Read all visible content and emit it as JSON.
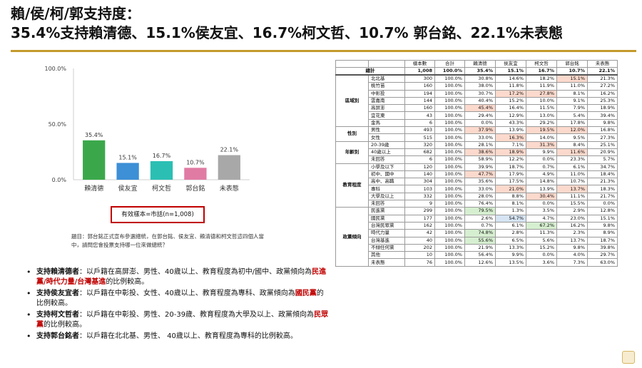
{
  "title": {
    "line1": "賴/侯/柯/郭支持度：",
    "line2": "35.4%支持賴清德、15.1%侯友宜、16.7%柯文哲、10.7% 郭台銘、22.1%未表態"
  },
  "chart_data": {
    "type": "bar",
    "categories": [
      "賴清德",
      "侯友宜",
      "柯文哲",
      "郭台銘",
      "未表態"
    ],
    "values": [
      35.4,
      15.1,
      16.7,
      10.7,
      22.1
    ],
    "value_labels": [
      "35.4%",
      "15.1%",
      "16.7%",
      "10.7%",
      "22.1%"
    ],
    "colors": [
      "#3aa84a",
      "#3d8fd6",
      "#2bbfb3",
      "#e07ba4",
      "#a8a8a8"
    ],
    "yticks": [
      "100.0%",
      "50.0%",
      "0.0%"
    ],
    "ylim": [
      0,
      100
    ],
    "grid": false,
    "legend": "none"
  },
  "notebox": "有效樣本=市話(n=1,008)",
  "question": "題目：郭台銘正式宣布參選總統，在郭台銘、侯友宜、賴清德和柯文哲這四個人當中，請問您會投票支持哪一位來做總統？",
  "bullets": [
    {
      "label": "支持賴清德者",
      "pre": "：以戶籍在高屏澎、男性、40歲以上、教育程度為初中/國中、政黨傾向為",
      "red": "民進黨/時代力量/台灣基進",
      "post": "的比例較高。"
    },
    {
      "label": "支持侯友宜者",
      "pre": "：以戶籍在中彰投、女性、40歲以上、教育程度為專科、政黨傾向為",
      "red": "國民黨",
      "post": "的比例較高。"
    },
    {
      "label": "支持柯文哲者",
      "pre": "：以戶籍在中彰投、男性、20-39歲、教育程度為大學及以上、政黨傾向為",
      "red": "民眾黨",
      "post": "的比例較高。"
    },
    {
      "label": "支持郭台銘者",
      "pre": "：以戶籍在北北基、男性、 40歲以上、教育程度為專科的比例較高。",
      "red": "",
      "post": ""
    }
  ],
  "table": {
    "headers": [
      "",
      "",
      "樣本數",
      "合計",
      "賴清德",
      "侯友宜",
      "柯文哲",
      "郭台銘",
      "未表態"
    ],
    "total": {
      "label": "總計",
      "cells": [
        "1,008",
        "100.0%",
        "35.4%",
        "15.1%",
        "16.7%",
        "10.7%",
        "22.1%"
      ]
    },
    "groups": [
      {
        "name": "區域別",
        "rows": [
          {
            "label": "北北基",
            "cells": [
              "300",
              "100.0%",
              "30.8%",
              "14.6%",
              "18.2%",
              "15.1%",
              "21.3%"
            ],
            "hl": {
              "5": "pink"
            }
          },
          {
            "label": "桃竹苗",
            "cells": [
              "160",
              "100.0%",
              "38.0%",
              "11.8%",
              "11.9%",
              "11.0%",
              "27.2%"
            ]
          },
          {
            "label": "中彰投",
            "cells": [
              "194",
              "100.0%",
              "30.7%",
              "17.2%",
              "27.8%",
              "8.1%",
              "16.2%"
            ],
            "hl": {
              "3": "pink",
              "4": "pink"
            }
          },
          {
            "label": "雲嘉南",
            "cells": [
              "144",
              "100.0%",
              "40.4%",
              "15.2%",
              "10.0%",
              "9.1%",
              "25.3%"
            ]
          },
          {
            "label": "高屏澎",
            "cells": [
              "160",
              "100.0%",
              "45.4%",
              "16.4%",
              "11.5%",
              "7.9%",
              "18.9%"
            ],
            "hl": {
              "2": "pink"
            }
          },
          {
            "label": "宜花東",
            "cells": [
              "43",
              "100.0%",
              "29.4%",
              "12.9%",
              "13.0%",
              "5.4%",
              "39.4%"
            ]
          },
          {
            "label": "金馬",
            "cells": [
              "6",
              "100.0%",
              "0.0%",
              "43.3%",
              "29.2%",
              "17.8%",
              "9.8%"
            ]
          }
        ]
      },
      {
        "name": "性別",
        "rows": [
          {
            "label": "男性",
            "cells": [
              "493",
              "100.0%",
              "37.9%",
              "13.9%",
              "19.5%",
              "12.0%",
              "16.8%"
            ],
            "hl": {
              "2": "pink",
              "4": "pink",
              "5": "pink"
            }
          },
          {
            "label": "女性",
            "cells": [
              "515",
              "100.0%",
              "33.0%",
              "16.3%",
              "14.0%",
              "9.5%",
              "27.3%"
            ],
            "hl": {
              "3": "pink"
            }
          }
        ]
      },
      {
        "name": "年齡別",
        "rows": [
          {
            "label": "20-39歲",
            "cells": [
              "320",
              "100.0%",
              "28.1%",
              "7.1%",
              "31.3%",
              "8.4%",
              "25.1%"
            ],
            "hl": {
              "4": "pink"
            }
          },
          {
            "label": "40歲以上",
            "cells": [
              "682",
              "100.0%",
              "38.6%",
              "18.9%",
              "9.9%",
              "11.6%",
              "20.9%"
            ],
            "hl": {
              "2": "pink",
              "3": "pink",
              "5": "pink"
            }
          },
          {
            "label": "未回答",
            "cells": [
              "6",
              "100.0%",
              "58.9%",
              "12.2%",
              "0.0%",
              "23.3%",
              "5.7%"
            ]
          }
        ]
      },
      {
        "name": "教育程度",
        "rows": [
          {
            "label": "小學及以下",
            "cells": [
              "120",
              "100.0%",
              "39.9%",
              "18.7%",
              "0.7%",
              "6.1%",
              "34.7%"
            ]
          },
          {
            "label": "初中、國中",
            "cells": [
              "140",
              "100.0%",
              "47.7%",
              "17.9%",
              "4.9%",
              "11.0%",
              "18.4%"
            ],
            "hl": {
              "2": "pink"
            }
          },
          {
            "label": "高中、高職",
            "cells": [
              "304",
              "100.0%",
              "35.6%",
              "17.5%",
              "14.8%",
              "10.7%",
              "21.3%"
            ]
          },
          {
            "label": "專科",
            "cells": [
              "103",
              "100.0%",
              "33.0%",
              "21.0%",
              "13.9%",
              "13.7%",
              "18.3%"
            ],
            "hl": {
              "3": "pink",
              "5": "pink"
            }
          },
          {
            "label": "大學及以上",
            "cells": [
              "332",
              "100.0%",
              "28.0%",
              "8.8%",
              "30.4%",
              "11.1%",
              "21.7%"
            ],
            "hl": {
              "4": "pink"
            }
          },
          {
            "label": "未回答",
            "cells": [
              "9",
              "100.0%",
              "76.4%",
              "8.1%",
              "0.0%",
              "15.5%",
              "0.0%"
            ]
          }
        ]
      },
      {
        "name": "政黨傾向",
        "rows": [
          {
            "label": "民進黨",
            "cells": [
              "299",
              "100.0%",
              "79.5%",
              "1.3%",
              "3.5%",
              "2.9%",
              "12.8%"
            ],
            "hl": {
              "2": "green"
            }
          },
          {
            "label": "國民黨",
            "cells": [
              "177",
              "100.0%",
              "2.6%",
              "54.7%",
              "4.7%",
              "23.0%",
              "15.1%"
            ],
            "hl": {
              "3": "blue"
            }
          },
          {
            "label": "台灣民眾黨",
            "cells": [
              "162",
              "100.0%",
              "0.7%",
              "6.1%",
              "67.2%",
              "16.2%",
              "9.8%"
            ],
            "hl": {
              "4": "green"
            }
          },
          {
            "label": "時代力量",
            "cells": [
              "42",
              "100.0%",
              "74.8%",
              "2.8%",
              "11.3%",
              "2.3%",
              "8.9%"
            ],
            "hl": {
              "2": "green"
            }
          },
          {
            "label": "台灣基進",
            "cells": [
              "40",
              "100.0%",
              "55.6%",
              "6.5%",
              "5.6%",
              "13.7%",
              "18.7%"
            ],
            "hl": {
              "2": "green"
            }
          },
          {
            "label": "不傾任何黨",
            "cells": [
              "202",
              "100.0%",
              "21.9%",
              "13.3%",
              "15.2%",
              "9.8%",
              "39.8%"
            ]
          },
          {
            "label": "其他",
            "cells": [
              "10",
              "100.0%",
              "56.4%",
              "9.9%",
              "0.0%",
              "4.0%",
              "29.7%"
            ]
          },
          {
            "label": "未表態",
            "cells": [
              "76",
              "100.0%",
              "12.6%",
              "13.5%",
              "3.6%",
              "7.3%",
              "63.0%"
            ]
          }
        ]
      }
    ]
  }
}
